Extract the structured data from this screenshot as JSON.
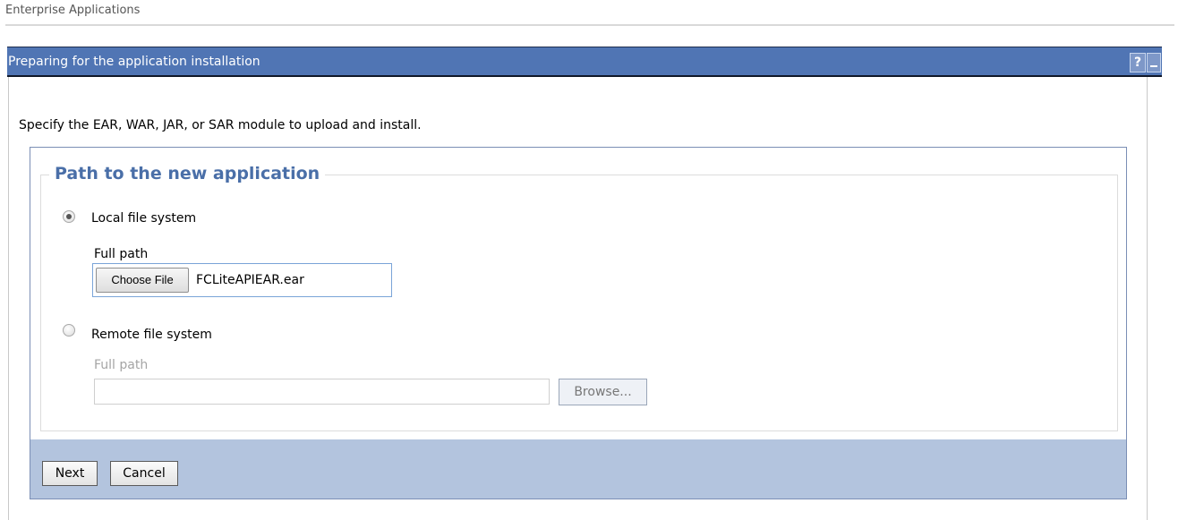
{
  "breadcrumb": "Enterprise Applications",
  "panel": {
    "title": "Preparing for the application installation",
    "help_label": "?"
  },
  "instruction": "Specify the EAR, WAR, JAR, or SAR module to upload and install.",
  "fieldset": {
    "legend": "Path to the new application",
    "local": {
      "label": "Local file system",
      "selected": true,
      "full_path_label": "Full path",
      "choose_file_label": "Choose File",
      "file_name": "FCLiteAPIEAR.ear"
    },
    "remote": {
      "label": "Remote file system",
      "selected": false,
      "full_path_label": "Full path",
      "path_value": "",
      "browse_label": "Browse..."
    }
  },
  "buttons": {
    "next": "Next",
    "cancel": "Cancel"
  },
  "colors": {
    "titlebar": "#5075b4",
    "legend_text": "#4a6fa8",
    "button_bar": "#b3c4de"
  }
}
